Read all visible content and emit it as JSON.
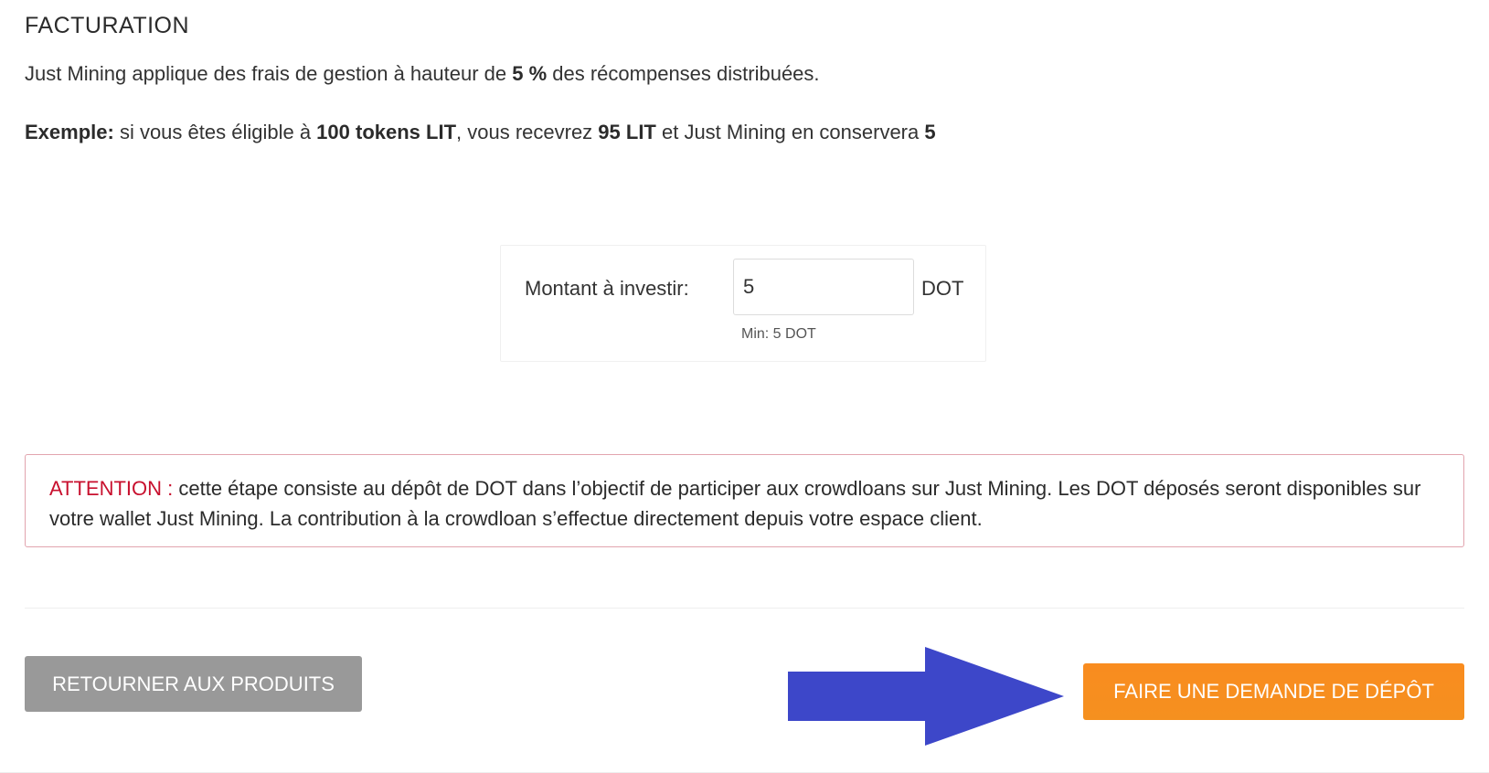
{
  "billing": {
    "title": "FACTURATION",
    "fee_text_before": "Just Mining applique des frais de gestion à hauteur de ",
    "fee_value": "5 %",
    "fee_text_after": " des récompenses distribuées.",
    "example_label": "Exemple:",
    "example_text_1": " si vous êtes éligible à ",
    "example_eligible": "100 tokens LIT",
    "example_text_2": ", vous recevrez ",
    "example_received": "95 LIT",
    "example_text_3": " et Just Mining en conservera ",
    "example_kept": "5"
  },
  "invest": {
    "label": "Montant à investir:",
    "value": "5",
    "unit": "DOT",
    "min_hint": "Min: 5 DOT"
  },
  "alert": {
    "label": "ATTENTION :",
    "message": " cette étape consiste au dépôt de DOT dans l’objectif de participer aux crowdloans sur Just Mining. Les DOT déposés seront disponibles sur votre wallet Just Mining. La contribution à la crowdloan s’effectue directement depuis votre espace client."
  },
  "actions": {
    "back_label": "RETOURNER AUX PRODUITS",
    "deposit_label": "FAIRE UNE DEMANDE DE DÉPÔT"
  },
  "annotation": {
    "arrow_icon": "arrow-right-icon",
    "arrow_color": "#3d47c9"
  },
  "colors": {
    "accent_orange": "#f98c1f",
    "back_gray": "#999999",
    "alert_red": "#c8102e",
    "alert_border": "#e2a4ae"
  }
}
